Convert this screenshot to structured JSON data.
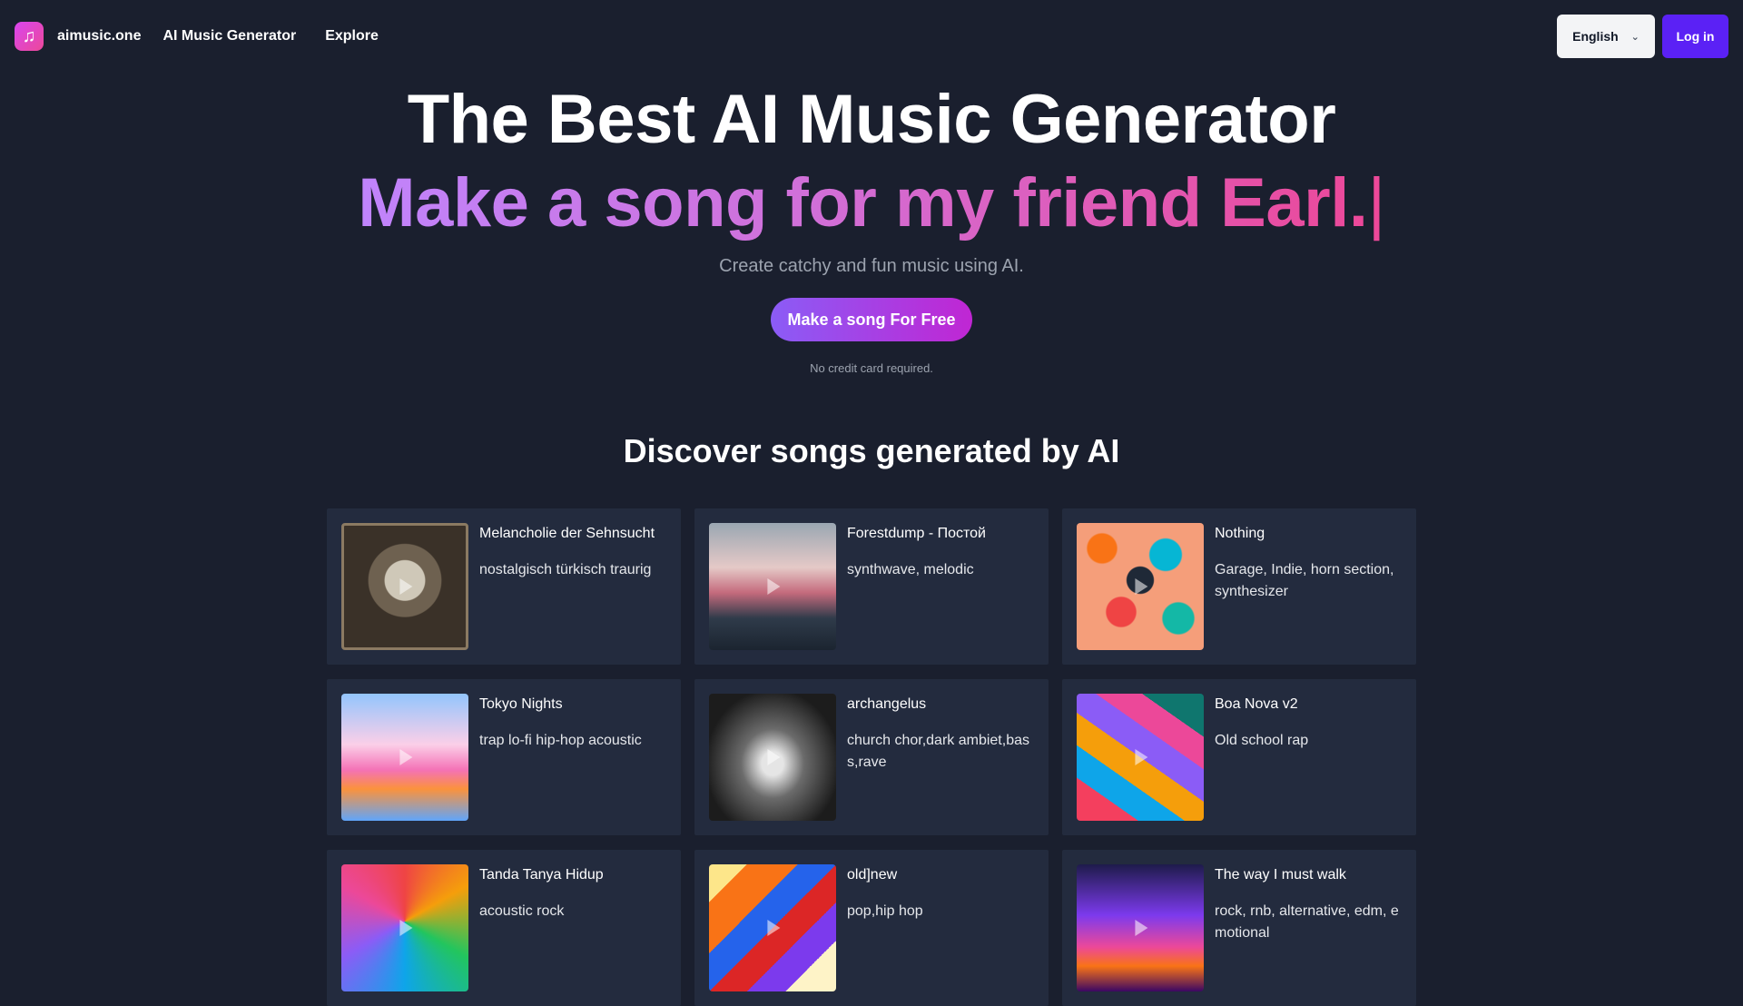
{
  "header": {
    "brand": "aimusic.one",
    "nav": [
      "AI Music Generator",
      "Explore"
    ],
    "language": "English",
    "login": "Log in"
  },
  "hero": {
    "title": "The Best AI Music Generator",
    "typed": "Make a song for my friend Earl.",
    "caret": "|",
    "subtitle": "Create catchy and fun music using AI.",
    "cta": "Make a song For Free",
    "note": "No credit card required."
  },
  "discover": {
    "title": "Discover songs generated by AI",
    "songs": [
      {
        "title": "Melancholie der Sehnsucht",
        "tags": "nostalgisch türkisch traurig"
      },
      {
        "title": "Forestdump - Постой",
        "tags": "synthwave, melodic"
      },
      {
        "title": "Nothing",
        "tags": "Garage, Indie, horn section, synthesizer"
      },
      {
        "title": "Tokyo Nights",
        "tags": "trap lo-fi hip-hop acoustic"
      },
      {
        "title": "archangelus",
        "tags": "church chor,dark ambiet,bass,rave"
      },
      {
        "title": "Boa Nova v2",
        "tags": "Old school rap"
      },
      {
        "title": "Tanda Tanya Hidup",
        "tags": "acoustic rock"
      },
      {
        "title": "old]new",
        "tags": "pop,hip hop"
      },
      {
        "title": "The way I must walk",
        "tags": "rock, rnb, alternative, edm, emotional"
      }
    ]
  },
  "colors": {
    "background": "#1a1f2e",
    "card": "#232b3e",
    "accent": "#5b21f5",
    "gradient_start": "#c084fc",
    "gradient_end": "#ec4899"
  },
  "icons": {
    "logo": "music-note-icon",
    "language": "chevron-down-icon",
    "thumb": "play-icon"
  }
}
